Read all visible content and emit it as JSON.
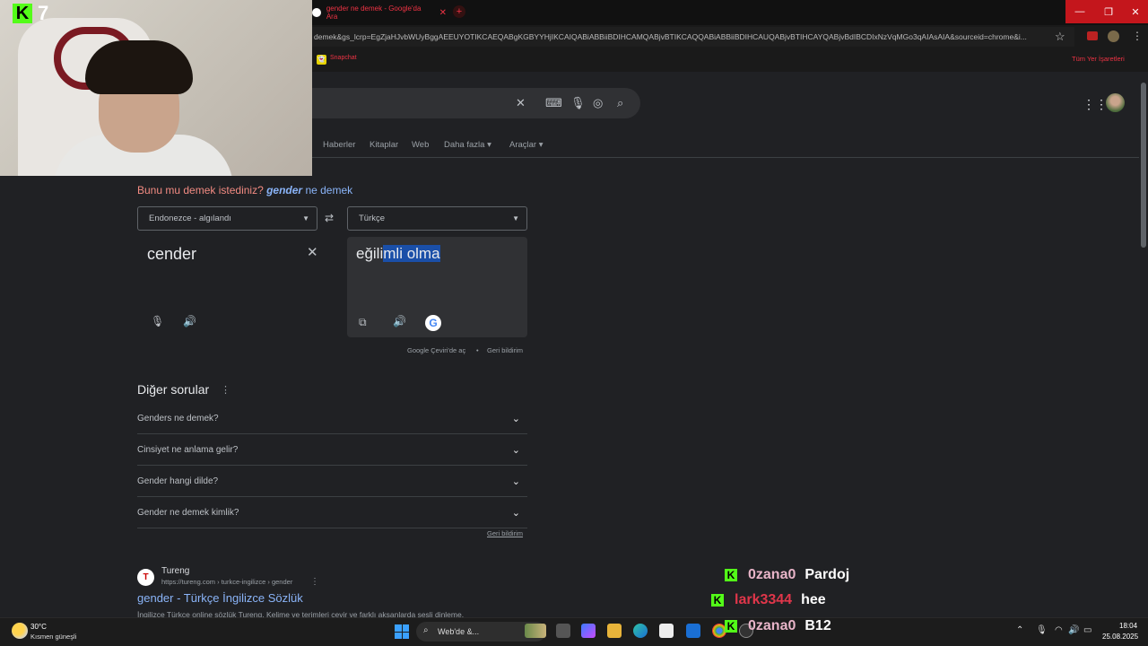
{
  "browser": {
    "tab_title": "gender ne demek - Google'da Ara",
    "url": "demek&gs_lcrp=EgZjaHJvbWUyBggAEEUYOTIKCAEQABgKGBYYHjIKCAIQABiABBiiBDIHCAMQABjvBTIKCAQQABiABBiiBDIHCAUQABjvBTIHCAYQABjvBdIBCDIxNzVqMGo3qAIAsAIA&sourceid=chrome&i...",
    "bookmark_label": "Snapchat",
    "all_bookmarks": "Tüm Yer İşaretleri"
  },
  "overlay": {
    "channel_number": "7",
    "kick_letter": "K"
  },
  "nav": {
    "tabs": [
      "Haberler",
      "Kitaplar",
      "Web",
      "Daha fazla",
      "Araçlar"
    ]
  },
  "did_you_mean": {
    "prefix": "Bunu mu demek istediniz?",
    "term": "gender",
    "suffix": "ne demek"
  },
  "translate": {
    "source_lang": "Endonezce - algılandı",
    "target_lang": "Türkçe",
    "source_text": "cender",
    "output_plain": "eğili",
    "output_selected": "mli olma",
    "open_in_translate": "Google Çeviri'de aç",
    "feedback": "Geri bildirim"
  },
  "paa": {
    "title": "Diğer sorular",
    "questions": [
      "Genders ne demek?",
      "Cinsiyet ne anlama gelir?",
      "Gender hangi dilde?",
      "Gender ne demek kimlik?"
    ],
    "feedback": "Geri bildirim"
  },
  "result": {
    "site": "Tureng",
    "url": "https://tureng.com › turkce-ingilizce › gender",
    "title": "gender - Türkçe İngilizce Sözlük",
    "snippet": "İngilizce Türkçe online sözlük Tureng. Kelime ve terimleri çevir ve farklı aksanlarda sesli dinleme."
  },
  "chat": [
    {
      "user": "0zana0",
      "message": "Pardoj",
      "color": "#e8b4c8"
    },
    {
      "user": "lark3344",
      "message": "hee",
      "color": "#e0364a"
    },
    {
      "user": "0zana0",
      "message": "B12",
      "color": "#e8b4c8"
    }
  ],
  "taskbar": {
    "temperature": "30°C",
    "weather": "Kısmen güneşli",
    "search_label": "Web'de &...",
    "time": "18:04",
    "date": "25.08.2025"
  },
  "colors": {
    "background": "#202124",
    "link": "#8ab4f8",
    "kick_green": "#53fc18",
    "selection": "#1a4fa8"
  }
}
